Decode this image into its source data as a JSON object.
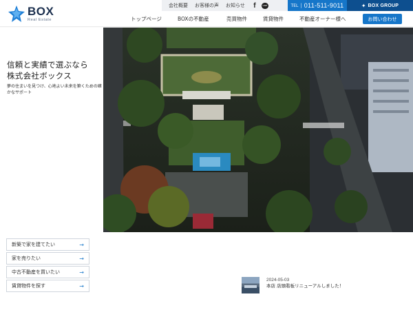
{
  "logo": {
    "name": "BOX",
    "sub": "Real Estate"
  },
  "utility": {
    "links": [
      "会社概要",
      "お客様の声",
      "お知らせ"
    ],
    "tel_label": "TEL",
    "tel_number": "011-511-9011",
    "group_name": "BOX GROUP"
  },
  "nav": {
    "items": [
      "トップページ",
      "BOXの不動産",
      "売買物件",
      "賃貸物件",
      "不動産オーナー様へ"
    ],
    "contact_label": "お問い合わせ"
  },
  "hero": {
    "title_line1": "信頼と実績で選ぶなら",
    "title_line2": "株式会社ボックス",
    "subtitle": "夢の住まいを見つけ、心地よい未来を築くための確かなサポート"
  },
  "quick_links": [
    "新築で家を建てたい",
    "家を売りたい",
    "中古不動産を買いたい",
    "賃貸物件を探す"
  ],
  "news": {
    "date": "2024-05-03",
    "title": "本店 店頭看板リニューアルしました！"
  },
  "colors": {
    "brand_blue": "#1676c9",
    "group_navy": "#0d4f8f",
    "logo_navy": "#1b2f4e"
  }
}
